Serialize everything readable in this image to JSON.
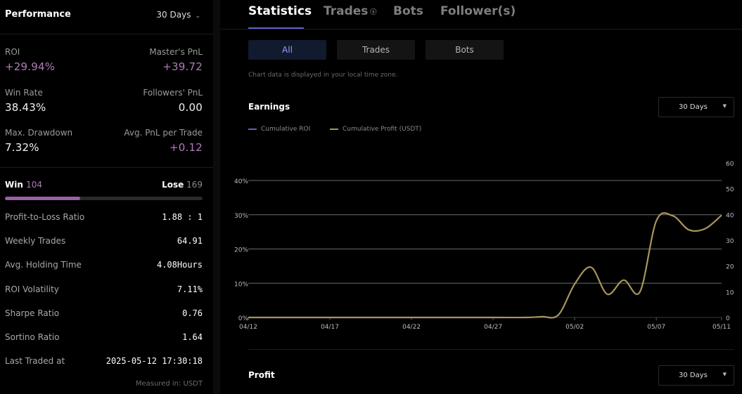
{
  "performance": {
    "title": "Performance",
    "period": "30 Days",
    "metrics": [
      {
        "label": "ROI",
        "value": "+29.94%",
        "highlight": true
      },
      {
        "label": "Master's PnL",
        "value": "+39.72",
        "highlight": true
      },
      {
        "label": "Win Rate",
        "value": "38.43%",
        "highlight": false
      },
      {
        "label": "Followers' PnL",
        "value": "0.00",
        "highlight": false
      },
      {
        "label": "Max. Drawdown",
        "value": "7.32%",
        "highlight": false
      },
      {
        "label": "Avg. PnL per Trade",
        "value": "+0.12",
        "highlight": true
      }
    ],
    "win_label": "Win",
    "win_count": "104",
    "lose_label": "Lose",
    "lose_count": "169",
    "win_fraction": 0.381,
    "stats": [
      {
        "label": "Profit-to-Loss Ratio",
        "value": "1.88 : 1"
      },
      {
        "label": "Weekly Trades",
        "value": "64.91"
      },
      {
        "label": "Avg. Holding Time",
        "value": "4.08Hours"
      },
      {
        "label": "ROI Volatility",
        "value": "7.11%"
      },
      {
        "label": "Sharpe Ratio",
        "value": "0.76"
      },
      {
        "label": "Sortino Ratio",
        "value": "1.64"
      },
      {
        "label": "Last Traded at",
        "value": "2025-05-12 17:30:18"
      }
    ],
    "measured_note": "Measured in: USDT"
  },
  "tabs": {
    "statistics": "Statistics",
    "trades": "Trades",
    "trades_icon": "circle-info-icon",
    "bots": "Bots",
    "followers": "Follower(s)"
  },
  "filters": {
    "all": "All",
    "trades": "Trades",
    "bots": "Bots"
  },
  "timezone_note": "Chart data is displayed in your local time zone.",
  "earnings": {
    "title": "Earnings",
    "period": "30 Days"
  },
  "profit": {
    "title": "Profit",
    "period": "30 Days"
  },
  "colors": {
    "accent": "#5d63c9",
    "purple": "#b07ab8",
    "profit_line": "#a8955c",
    "roi_line": "#5d63c9"
  },
  "chart_data": {
    "type": "line",
    "title": "Earnings",
    "legend": [
      "Cumulative ROI",
      "Cumulative Profit (USDT)"
    ],
    "legend_position": "top-left",
    "x_ticks": [
      "04/12",
      "04/17",
      "04/22",
      "04/27",
      "05/02",
      "05/07",
      "05/11"
    ],
    "y_left_ticks": [
      "0%",
      "10%",
      "20%",
      "30%",
      "40%"
    ],
    "y_left_range": [
      0,
      40
    ],
    "y_right_ticks": [
      "0",
      "10",
      "20",
      "30",
      "40",
      "50",
      "60"
    ],
    "y_right_range": [
      0,
      60
    ],
    "grid": true,
    "series": [
      {
        "name": "Cumulative Profit (USDT)",
        "axis": "right",
        "x": [
          "04/12",
          "04/17",
          "04/22",
          "04/27",
          "04/29",
          "04/30",
          "05/01",
          "05/02",
          "05/03",
          "05/04",
          "05/05",
          "05/06",
          "05/07",
          "05/08",
          "05/09",
          "05/10",
          "05/11"
        ],
        "values": [
          0,
          0,
          0,
          0,
          0,
          0.3,
          1,
          13,
          19.5,
          9,
          14.5,
          10,
          37.5,
          39.5,
          34,
          34.5,
          39.7
        ]
      }
    ]
  }
}
